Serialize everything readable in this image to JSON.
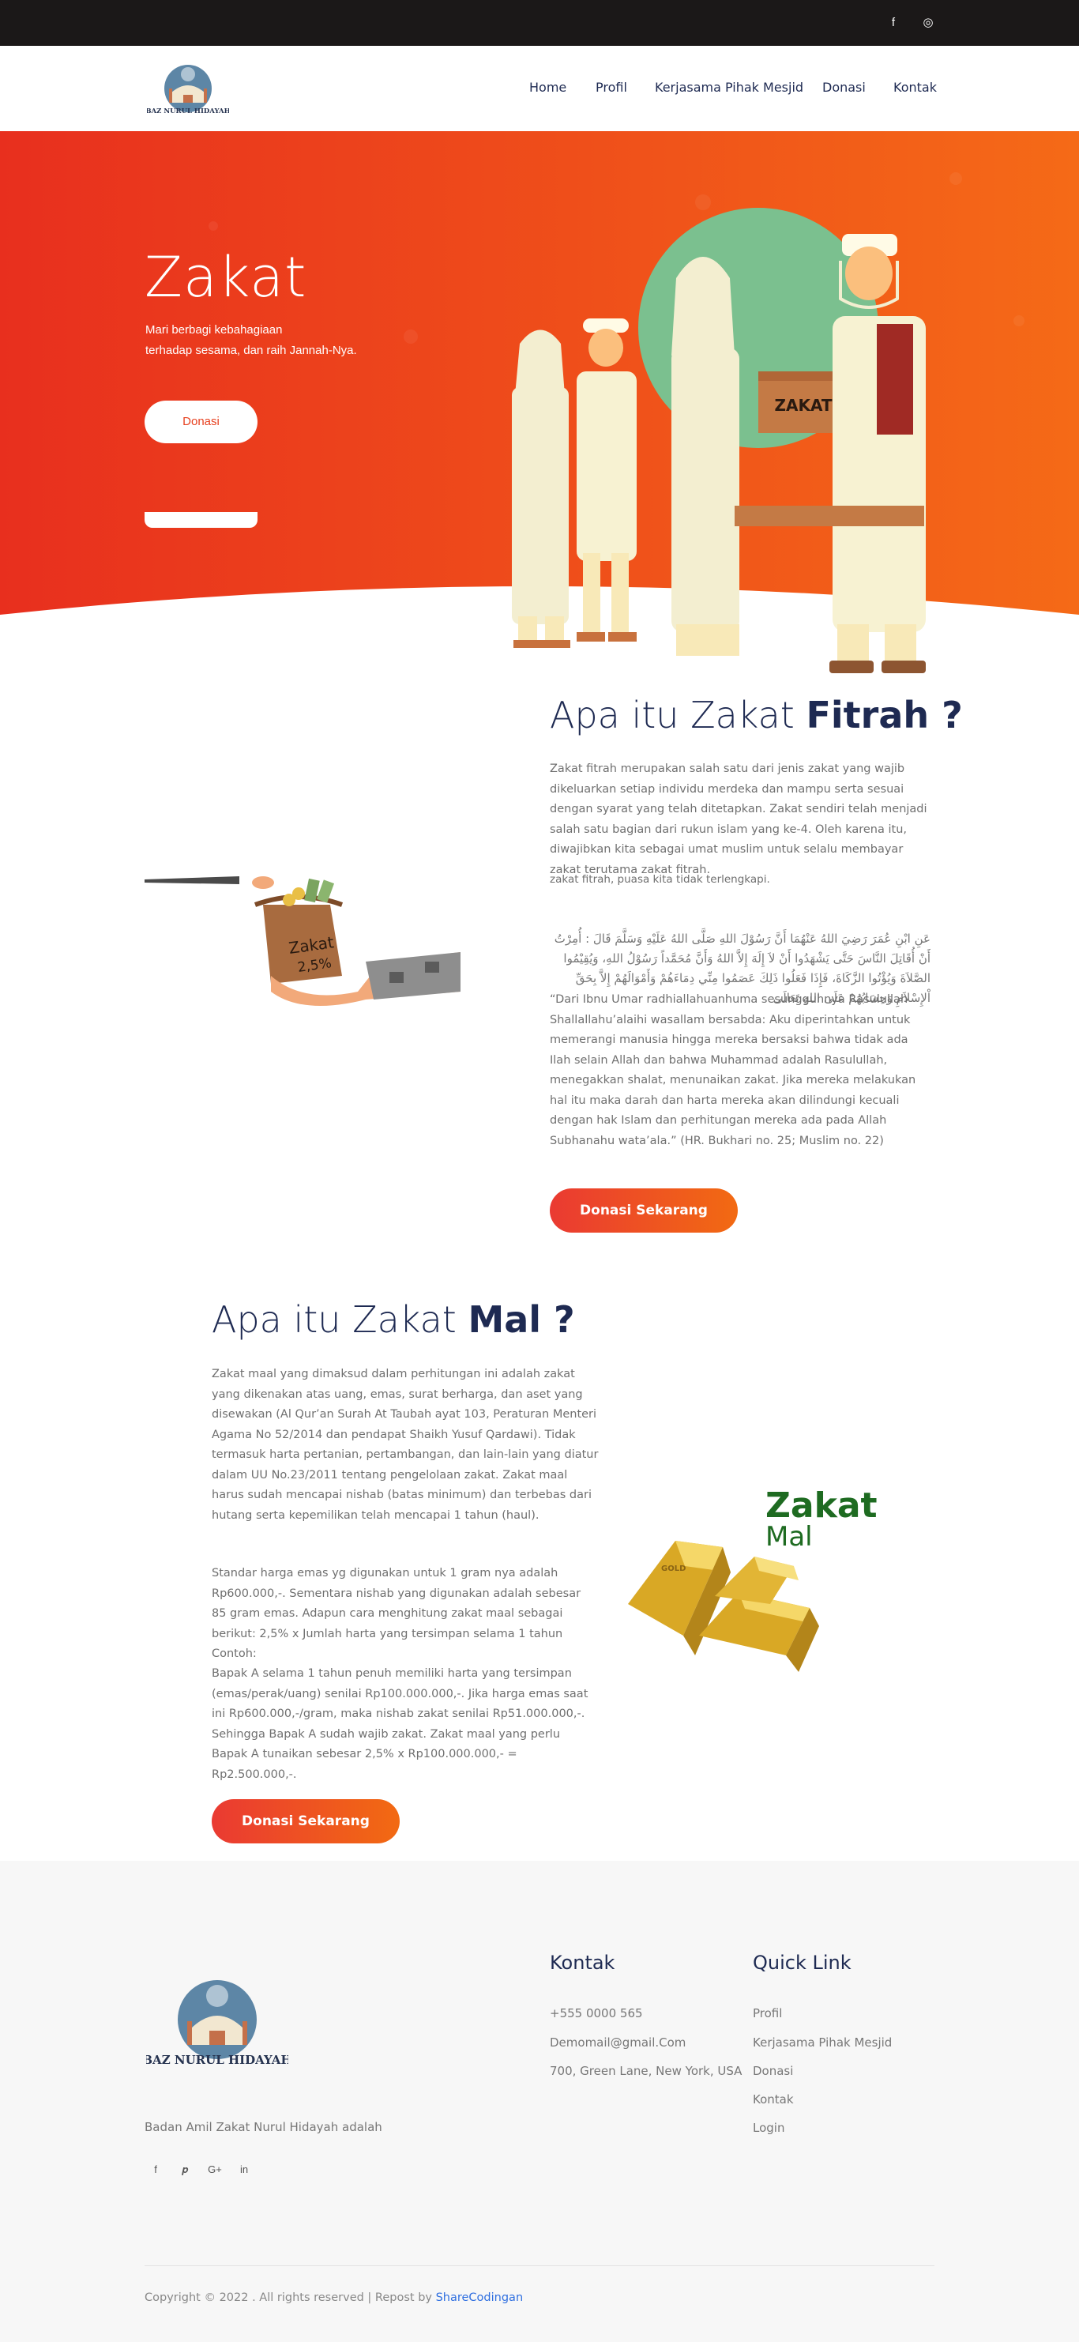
{
  "topbar": {
    "facebook_icon": "f",
    "instagram_icon": "◎"
  },
  "brand": {
    "logo_text": "BAZ NURUL HIDAYAH"
  },
  "nav": {
    "home": "Home",
    "profil": "Profil",
    "kerjasama": "Kerjasama Pihak Mesjid",
    "donasi": "Donasi",
    "kontak": "Kontak"
  },
  "hero": {
    "title": "Zakat",
    "subtitle_line1": "Mari berbagi kebahagiaan",
    "subtitle_line2": "terhadap sesama, dan raih Jannah-Nya.",
    "button": "Donasi",
    "box_label": "ZAKAT"
  },
  "fitrah": {
    "title_normal": "Apa itu Zakat ",
    "title_bold": "Fitrah ?",
    "paragraph": "Zakat fitrah merupakan salah satu dari jenis zakat yang wajib dikeluarkan setiap individu merdeka dan mampu serta sesuai dengan syarat yang telah ditetapkan. Zakat sendiri telah menjadi salah satu bagian dari rukun islam yang ke-4. Oleh karena itu, diwajibkan kita sebagai umat muslim untuk selalu membayar zakat terutama zakat fitrah.",
    "overflow_line": "zakat fitrah, puasa kita tidak terlengkapi.",
    "arabic": "عَنِ ابْنِ عُمَرَ رَضِيَ اللهُ عَنْهُمَا أَنَّ رَسُوْلَ اللهِ صَلَّى اللهُ عَلَيْهِ وَسَلَّمَ قَالَ : أُمِرْتُ أَنْ أُقَاتِلَ النَّاسَ حَتَّى يَشْهَدُوا أَنْ لاَ إِلَهَ إِلاَّ اللهُ وَأَنَّ مُحَمَّداً رَسُوْلُ اللهِ، وَيُقِيْمُوا الصَّلاَةَ وَيُؤْتُوا الزَّكَاةَ، فَإِذَا فَعَلُوا ذَلِكَ عَصَمُوا مِنِّي دِمَاءَهُمْ وَأَمْوَالَهُمْ إِلاَّ بِحَقِّ اْلإِسْلاَمِ وَحِسَابُهُمْ عَلَى اللهِ تَعَالَى",
    "hadith": "“Dari Ibnu Umar radhiallahuanhuma sesungguhnya Rasulullah Shallallahu’alaihi wasallam bersabda: Aku diperintahkan untuk memerangi manusia hingga mereka bersaksi bahwa tidak ada Ilah selain Allah dan bahwa Muhammad adalah Rasulullah, menegakkan shalat, menunaikan zakat. Jika mereka melakukan hal itu maka darah dan harta mereka akan dilindungi kecuali dengan hak Islam dan perhitungan mereka ada pada Allah Subhanahu wata’ala.” (HR. Bukhari no. 25; Muslim no. 22)",
    "button": "Donasi Sekarang",
    "bag_label_1": "Zakat",
    "bag_label_2": "2,5%"
  },
  "mal": {
    "title_normal": "Apa itu Zakat ",
    "title_bold": "Mal ?",
    "paragraph1": "Zakat maal yang dimaksud dalam perhitungan ini adalah zakat yang dikenakan atas uang, emas, surat berharga, dan aset yang disewakan (Al Qur’an Surah At Taubah ayat 103, Peraturan Menteri Agama No 52/2014 dan pendapat Shaikh Yusuf Qardawi). Tidak termasuk harta pertanian, pertambangan, dan lain-lain yang diatur dalam UU No.23/2011 tentang pengelolaan zakat. Zakat maal harus sudah mencapai nishab (batas minimum) dan terbebas dari hutang serta kepemilikan telah mencapai 1 tahun (haul).",
    "paragraph2": "Standar harga emas yg digunakan untuk 1 gram nya adalah Rp600.000,-. Sementara nishab yang digunakan adalah sebesar 85 gram emas. Adapun cara menghitung zakat maal sebagai berikut: 2,5% x Jumlah harta yang tersimpan selama 1 tahun",
    "contoh_label": "Contoh:",
    "paragraph3": "Bapak A selama 1 tahun penuh memiliki harta yang tersimpan (emas/perak/uang) senilai Rp100.000.000,-. Jika harga emas saat ini Rp600.000,-/gram, maka nishab zakat senilai Rp51.000.000,-. Sehingga Bapak A sudah wajib zakat. Zakat maal yang perlu Bapak A tunaikan sebesar 2,5% x Rp100.000.000,- = Rp2.500.000,-.",
    "button": "Donasi Sekarang",
    "image_title_1": "Zakat",
    "image_title_2": "Mal",
    "gold_label": "GOLD"
  },
  "footer": {
    "logo_text": "BAZ NURUL HIDAYAH",
    "about": "Badan Amil Zakat Nurul Hidayah adalah",
    "kontak_title": "Kontak",
    "phone": "+555 0000 565",
    "email": "Demomail@gmail.Com",
    "address": "700, Green Lane, New York, USA",
    "quicklink_title": "Quick Link",
    "links": [
      "Profil",
      "Kerjasama Pihak Mesjid",
      "Donasi",
      "Kontak",
      "Login"
    ],
    "social": [
      "f",
      "𝒑",
      "G+",
      "in"
    ],
    "copyright_text": "Copyright © 2022 . All rights reserved | Repost by ",
    "copyright_link": "ShareCodingan"
  },
  "colors": {
    "hero_start": "#e82f1e",
    "hero_end": "#f56a17",
    "navy": "#1e2a52",
    "accent_green": "#7bc08f"
  }
}
